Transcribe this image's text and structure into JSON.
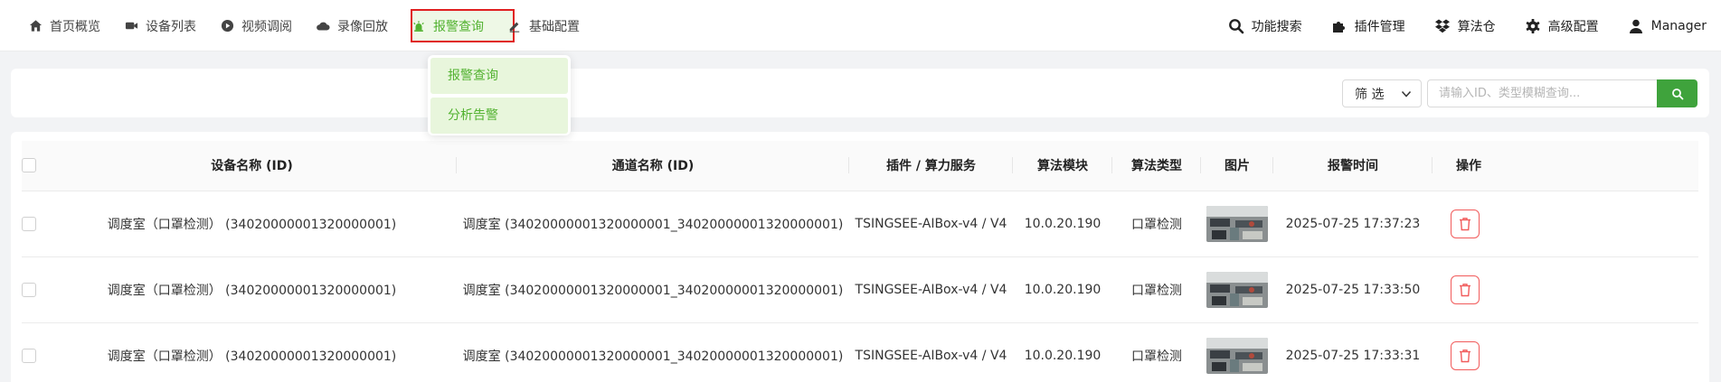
{
  "nav": {
    "left": [
      {
        "label": "首页概览",
        "icon": "home-icon"
      },
      {
        "label": "设备列表",
        "icon": "camera-icon"
      },
      {
        "label": "视频调阅",
        "icon": "play-circle-icon"
      },
      {
        "label": "录像回放",
        "icon": "cloud-icon"
      },
      {
        "label": "报警查询",
        "icon": "alarm-bell-icon",
        "active": true
      },
      {
        "label": "基础配置",
        "icon": "edit-icon"
      }
    ],
    "right": [
      {
        "label": "功能搜索",
        "icon": "search-icon"
      },
      {
        "label": "插件管理",
        "icon": "puzzle-icon"
      },
      {
        "label": "算法仓",
        "icon": "dropbox-icon"
      },
      {
        "label": "高级配置",
        "icon": "gear-icon"
      },
      {
        "label": "Manager",
        "icon": "user-icon"
      }
    ]
  },
  "dropdown": {
    "items": [
      "报警查询",
      "分析告警"
    ]
  },
  "filter": {
    "select_label": "筛 选",
    "search_placeholder": "请输入ID、类型模糊查询..."
  },
  "table": {
    "headers": [
      "设备名称 (ID)",
      "通道名称 (ID)",
      "插件 / 算力服务",
      "算法模块",
      "算法类型",
      "图片",
      "报警时间",
      "操作"
    ],
    "rows": [
      {
        "device": "调度室（口罩检测） (34020000001320000001)",
        "channel": "调度室 (34020000001320000001_34020000001320000001)",
        "plugin": "TSINGSEE-AIBox-v4 / V4",
        "module": "10.0.20.190",
        "type": "口罩检测",
        "time": "2025-07-25 17:37:23"
      },
      {
        "device": "调度室（口罩检测） (34020000001320000001)",
        "channel": "调度室 (34020000001320000001_34020000001320000001)",
        "plugin": "TSINGSEE-AIBox-v4 / V4",
        "module": "10.0.20.190",
        "type": "口罩检测",
        "time": "2025-07-25 17:33:50"
      },
      {
        "device": "调度室（口罩检测） (34020000001320000001)",
        "channel": "调度室 (34020000001320000001_34020000001320000001)",
        "plugin": "TSINGSEE-AIBox-v4 / V4",
        "module": "10.0.20.190",
        "type": "口罩检测",
        "time": "2025-07-25 17:33:31"
      }
    ]
  },
  "colors": {
    "accent": "#52b230",
    "active_bg": "#eef8e6",
    "highlight_border": "#e02020",
    "delete": "#f15b5b",
    "search_button": "#3fa33c"
  }
}
